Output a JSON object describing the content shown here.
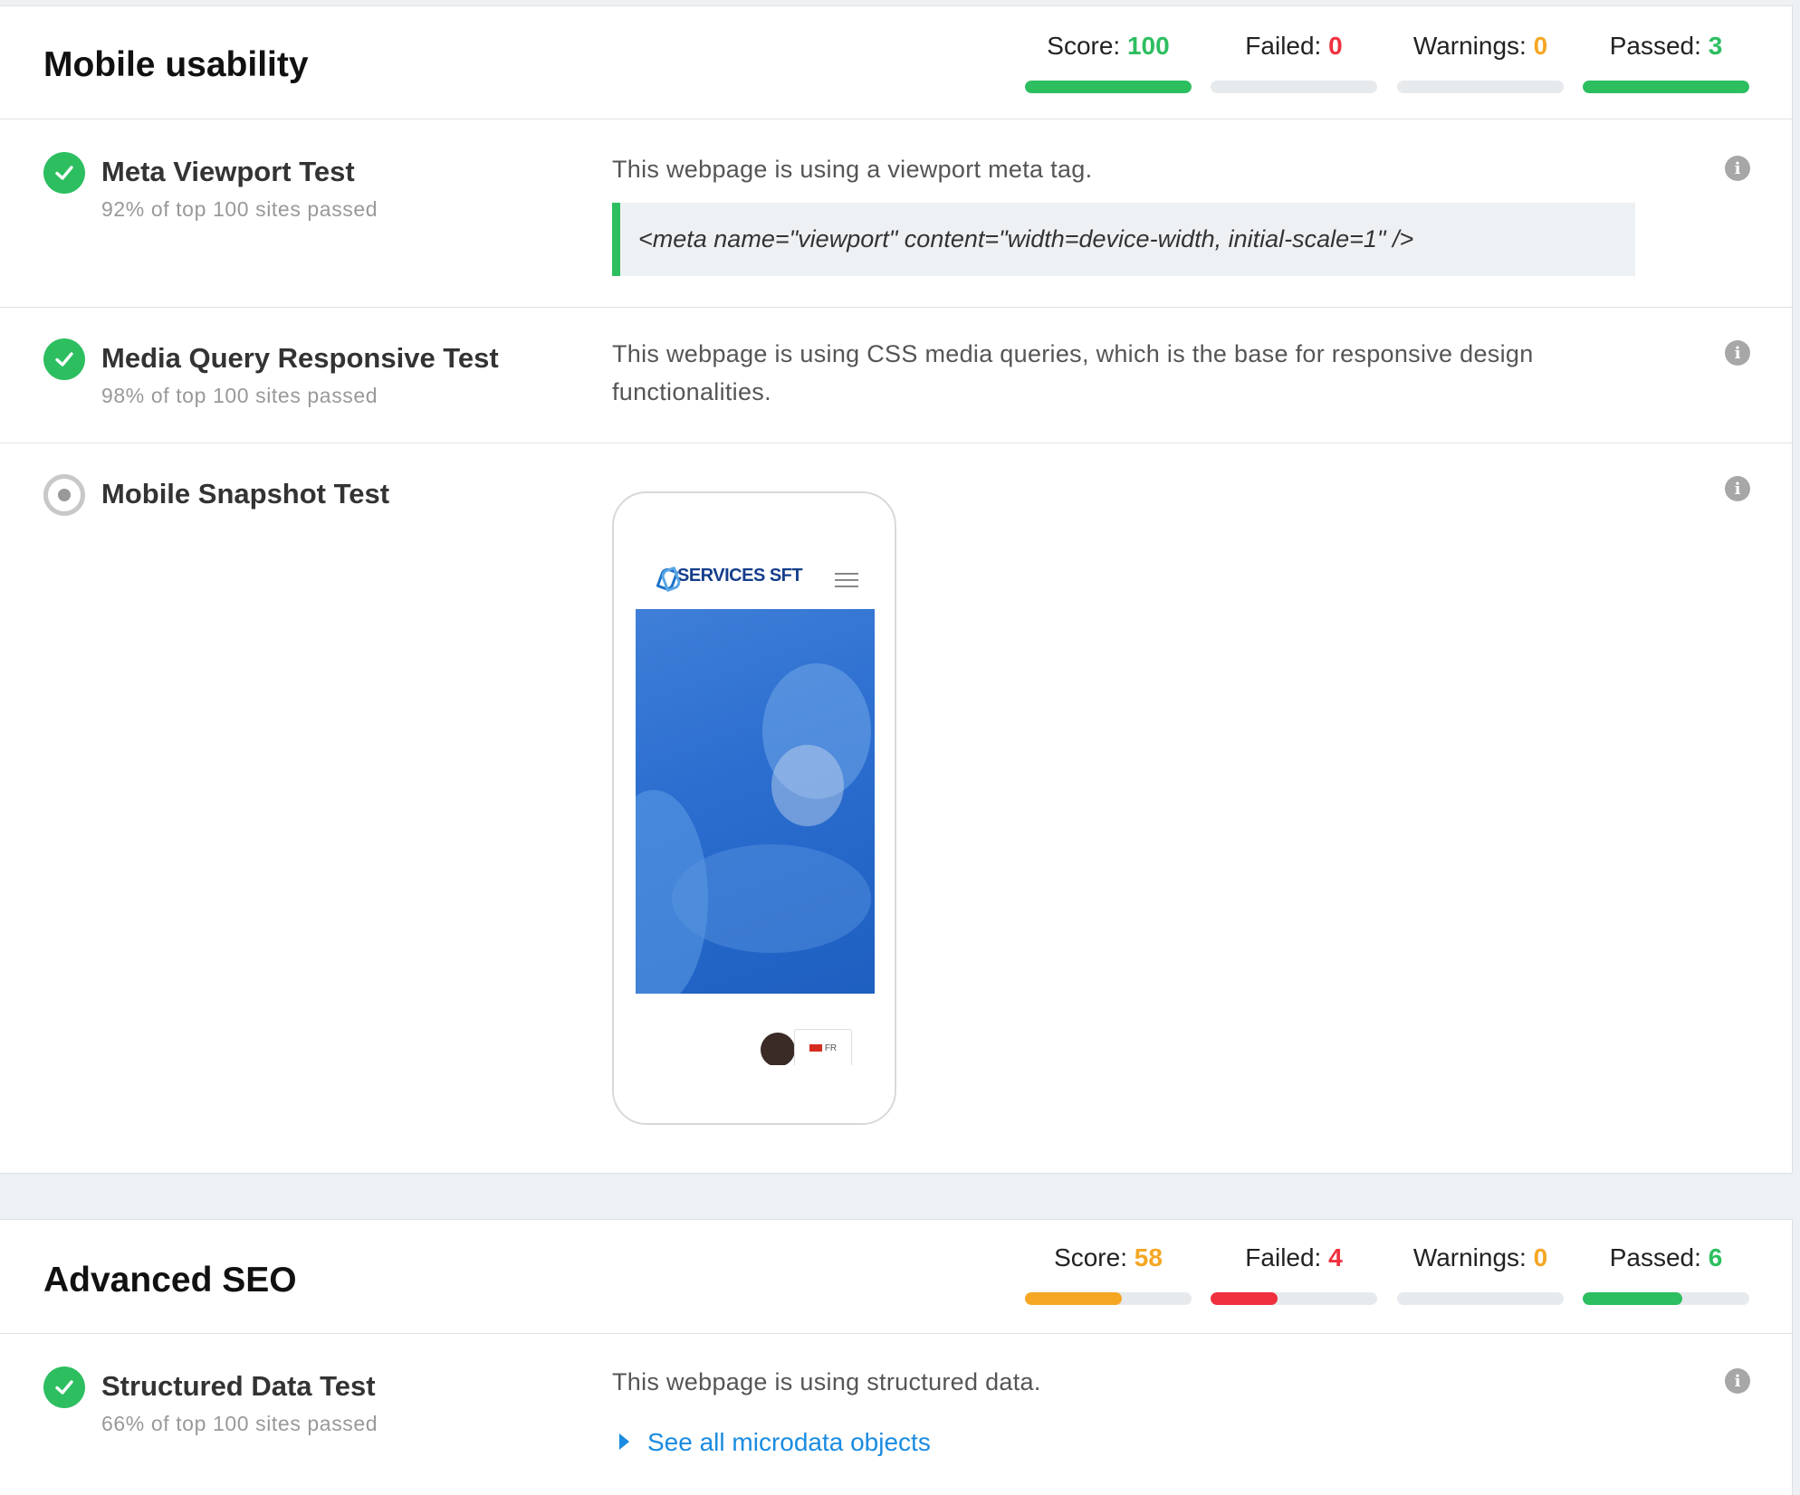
{
  "mobile": {
    "title": "Mobile usability",
    "stats": {
      "score": {
        "label": "Score: ",
        "value": "100",
        "color": "#2dbe60",
        "fill": 1.0
      },
      "failed": {
        "label": "Failed: ",
        "value": "0",
        "color": "#f0303e",
        "fill": 0
      },
      "warnings": {
        "label": "Warnings: ",
        "value": "0",
        "color": "#f5a623",
        "fill": 0
      },
      "passed": {
        "label": "Passed: ",
        "value": "3",
        "color": "#2dbe60",
        "fill": 1.0
      }
    },
    "tests": [
      {
        "title": "Meta Viewport Test",
        "sub": "92% of top 100 sites passed",
        "desc": "This webpage is using a viewport meta tag.",
        "code": "<meta name=\"viewport\" content=\"width=device-width, initial-scale=1\" />"
      },
      {
        "title": "Media Query Responsive Test",
        "sub": "98% of top 100 sites passed",
        "desc": "This webpage is using CSS media queries, which is the base for responsive design functionalities."
      },
      {
        "title": "Mobile Snapshot Test",
        "phone_brand": "SERVICES SFT",
        "phone_lang": "FR"
      }
    ]
  },
  "seo": {
    "title": "Advanced SEO",
    "stats": {
      "score": {
        "label": "Score: ",
        "value": "58",
        "color": "#f5a623",
        "fill": 0.58
      },
      "failed": {
        "label": "Failed: ",
        "value": "4",
        "color": "#f0303e",
        "fill": 0.4
      },
      "warnings": {
        "label": "Warnings: ",
        "value": "0",
        "color": "#f5a623",
        "fill": 0
      },
      "passed": {
        "label": "Passed: ",
        "value": "6",
        "color": "#2dbe60",
        "fill": 0.6
      }
    },
    "tests": [
      {
        "title": "Structured Data Test",
        "sub": "66% of top 100 sites passed",
        "desc": "This webpage is using structured data.",
        "link": "See all microdata objects"
      }
    ]
  },
  "icons": {
    "pass": "check-circle-icon",
    "neutral": "radio-dot-icon",
    "info": "info-icon",
    "info_glyph": "i"
  }
}
